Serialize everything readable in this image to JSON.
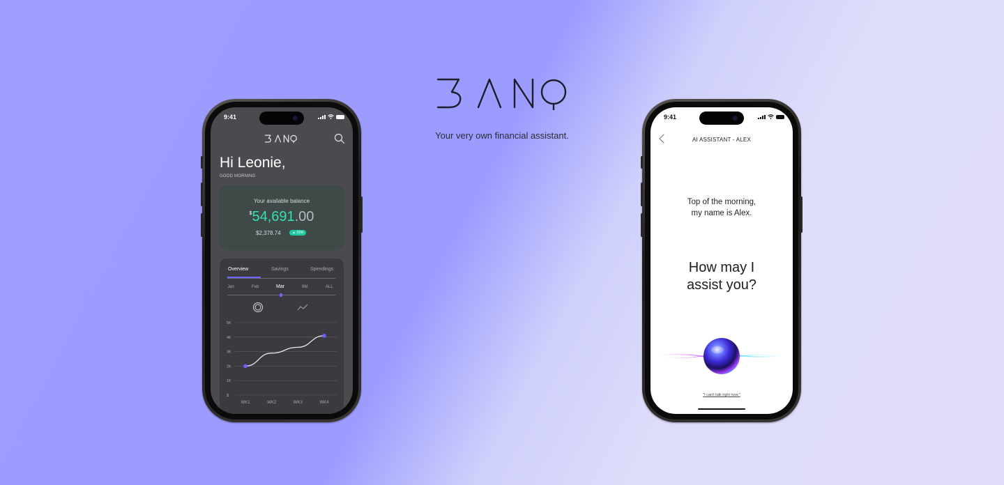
{
  "brand": {
    "logo_text": "BANQ",
    "tagline": "Your very own financial assistant."
  },
  "left_phone": {
    "status_time": "9:41",
    "logo_text": "BANQ",
    "greeting": "Hi Leonie,",
    "greeting_sub": "GOOD MORNING",
    "balance": {
      "label": "Your available balance",
      "currency": "$",
      "amount_int": "54,691",
      "amount_dec": ".00",
      "change_amount": "$2,378.74",
      "change_badge": "▲ 15%"
    },
    "tabs": [
      "Overview",
      "Savings",
      "Spendings"
    ],
    "active_tab": "Overview",
    "periods": [
      "Jan",
      "Feb",
      "Mar",
      "6M",
      "ALL"
    ],
    "active_period": "Mar"
  },
  "chart_data": {
    "type": "line",
    "x": [
      "WK1",
      "WK2",
      "WK3",
      "WK4"
    ],
    "yticks": [
      "$",
      "1K",
      "2K",
      "3K",
      "4K",
      "5K"
    ],
    "ylim": [
      0,
      5000
    ],
    "series": [
      {
        "values": [
          2000,
          2900,
          3300,
          4100
        ]
      }
    ],
    "grid": true,
    "colors": {
      "line": "#e8e8ec",
      "points": "#6b63ff"
    }
  },
  "right_phone": {
    "status_time": "9:41",
    "title": "AI ASSISTANT - ALEX",
    "intro_line1": "Top of the morning,",
    "intro_line2": "my name is Alex.",
    "question_line1": "How may I",
    "question_line2": "assist you?",
    "dismiss": "\"I can't talk right now.\""
  },
  "colors": {
    "accent": "#6b63ff",
    "positive": "#36e0b8",
    "badge": "#1fc9a3"
  }
}
